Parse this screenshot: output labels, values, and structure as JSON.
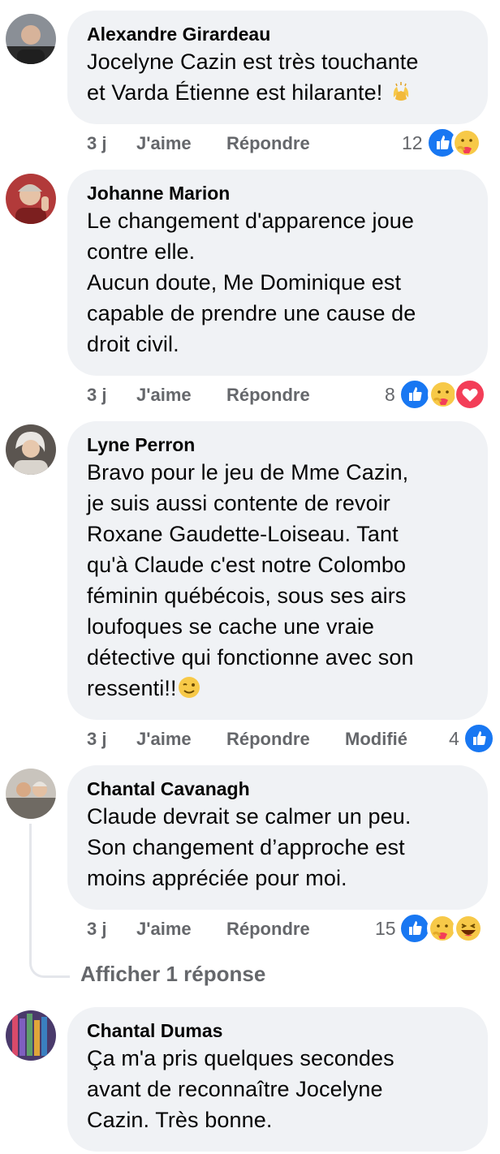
{
  "comments": [
    {
      "name": "Alexandre Girardeau",
      "text": "Jocelyne Cazin est très touchante\net Varda Étienne est hilarante!",
      "emoji": "raising-hands",
      "time": "3 j",
      "like": "J'aime",
      "reply": "Répondre",
      "edited": "",
      "reactions_count": "12",
      "reactions": [
        "like-icon",
        "care-icon"
      ]
    },
    {
      "name": "Johanne Marion",
      "text": "Le changement d'apparence joue\ncontre elle.\nAucun doute, Me Dominique est\ncapable de prendre une cause de\ndroit civil.",
      "time": "3 j",
      "like": "J'aime",
      "reply": "Répondre",
      "edited": "",
      "reactions_count": "8",
      "reactions": [
        "like-icon",
        "care-icon",
        "love-icon"
      ]
    },
    {
      "name": "Lyne Perron",
      "text": "Bravo pour le jeu de Mme Cazin,\nje suis aussi contente de revoir\nRoxane Gaudette-Loiseau. Tant\nqu'à Claude c'est notre Colombo\nféminin québécois, sous ses airs\nloufoques se cache une vraie\ndétective qui fonctionne avec son\nressenti!!",
      "emoji": "wink",
      "time": "3 j",
      "like": "J'aime",
      "reply": "Répondre",
      "edited": "Modifié",
      "reactions_count": "4",
      "reactions": [
        "like-icon"
      ]
    },
    {
      "name": "Chantal Cavanagh",
      "text": "Claude devrait se calmer un peu.\nSon changement d’approche est\nmoins appréciée pour moi.",
      "time": "3 j",
      "like": "J'aime",
      "reply": "Répondre",
      "edited": "",
      "reactions_count": "15",
      "reactions": [
        "like-icon",
        "care-icon",
        "haha-icon"
      ]
    },
    {
      "name": "Chantal Dumas",
      "text": "Ça m'a pris quelques secondes\navant de reconnaître Jocelyne\nCazin. Très bonne."
    }
  ],
  "view_replies": "Afficher 1 réponse",
  "colors": {
    "bubble": "#f0f2f5",
    "meta": "#65676b",
    "like": "#1877f2",
    "love": "#f33e58"
  }
}
